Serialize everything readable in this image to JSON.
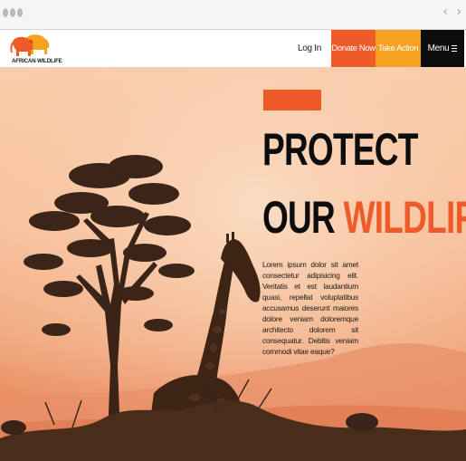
{
  "browser": {
    "back_icon": "chevron-left-icon",
    "forward_icon": "chevron-right-icon",
    "back_glyph": "‹",
    "forward_glyph": "›"
  },
  "header": {
    "logo_text": "AFRICAN WILDLIFE",
    "nav": {
      "login": "Log In",
      "donate": "Donate Now",
      "take_action": "Take Action",
      "menu": "Menu"
    }
  },
  "hero": {
    "headline_line1": "PROTECT",
    "headline_line2_word1": "OUR",
    "headline_line2_word2": "WILDLIFE",
    "body": "Lorem ipsum dolor sit amet consectetur adipisicing elit. Veritatis et est laudantium quasi, repellat voluptatibus accusamus deserunt maiores dolore veniam doloremque architecto dolorem sit consequatur. Debitis veniam commodi vitae eaque?"
  },
  "colors": {
    "accent": "#ee5a28",
    "secondary": "#f6a221",
    "dark": "#0d0d0d",
    "sky": "#f7c29e"
  }
}
